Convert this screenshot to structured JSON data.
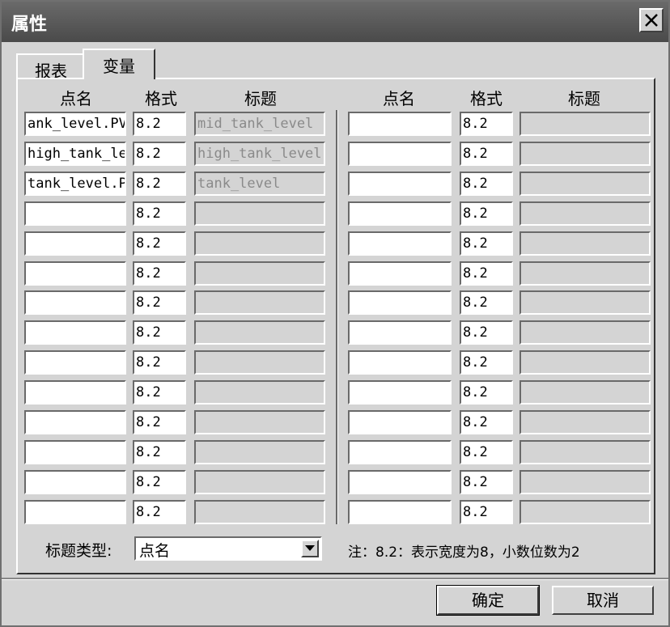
{
  "window": {
    "title": "属性",
    "close_icon": "close-icon"
  },
  "tabs": [
    {
      "label": "报表",
      "active": false
    },
    {
      "label": "变量",
      "active": true
    }
  ],
  "columns": {
    "point_name": "点名",
    "format": "格式",
    "caption": "标题"
  },
  "left_rows": [
    {
      "point": "ank_level.PV",
      "format": "8.2",
      "caption": "mid_tank_level"
    },
    {
      "point": "high_tank_le",
      "format": "8.2",
      "caption": "high_tank_level"
    },
    {
      "point": "tank_level.P",
      "format": "8.2",
      "caption": "tank_level"
    },
    {
      "point": "",
      "format": "8.2",
      "caption": ""
    },
    {
      "point": "",
      "format": "8.2",
      "caption": ""
    },
    {
      "point": "",
      "format": "8.2",
      "caption": ""
    },
    {
      "point": "",
      "format": "8.2",
      "caption": ""
    },
    {
      "point": "",
      "format": "8.2",
      "caption": ""
    },
    {
      "point": "",
      "format": "8.2",
      "caption": ""
    },
    {
      "point": "",
      "format": "8.2",
      "caption": ""
    },
    {
      "point": "",
      "format": "8.2",
      "caption": ""
    },
    {
      "point": "",
      "format": "8.2",
      "caption": ""
    },
    {
      "point": "",
      "format": "8.2",
      "caption": ""
    },
    {
      "point": "",
      "format": "8.2",
      "caption": ""
    }
  ],
  "right_rows": [
    {
      "point": "",
      "format": "8.2",
      "caption": ""
    },
    {
      "point": "",
      "format": "8.2",
      "caption": ""
    },
    {
      "point": "",
      "format": "8.2",
      "caption": ""
    },
    {
      "point": "",
      "format": "8.2",
      "caption": ""
    },
    {
      "point": "",
      "format": "8.2",
      "caption": ""
    },
    {
      "point": "",
      "format": "8.2",
      "caption": ""
    },
    {
      "point": "",
      "format": "8.2",
      "caption": ""
    },
    {
      "point": "",
      "format": "8.2",
      "caption": ""
    },
    {
      "point": "",
      "format": "8.2",
      "caption": ""
    },
    {
      "point": "",
      "format": "8.2",
      "caption": ""
    },
    {
      "point": "",
      "format": "8.2",
      "caption": ""
    },
    {
      "point": "",
      "format": "8.2",
      "caption": ""
    },
    {
      "point": "",
      "format": "8.2",
      "caption": ""
    },
    {
      "point": "",
      "format": "8.2",
      "caption": ""
    }
  ],
  "caption_type": {
    "label": "标题类型:",
    "value": "点名",
    "arrow_icon": "dropdown-arrow-icon"
  },
  "note": "注：8.2：表示宽度为8，小数位数为2",
  "buttons": {
    "ok": "确定",
    "cancel": "取消"
  }
}
